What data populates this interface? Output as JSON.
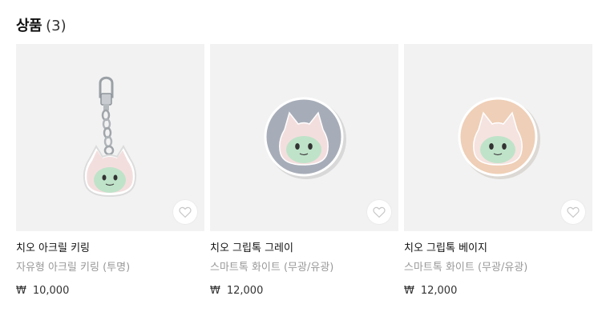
{
  "section": {
    "title": "상품",
    "count": "(3)"
  },
  "products": [
    {
      "title": "치오 아크릴 키링",
      "subtitle": "자유형 아크릴 키링 (투명)",
      "currency": "₩",
      "price": "10,000",
      "image_icon": "acrylic-keyring-image",
      "background_color": "#f2f2f2"
    },
    {
      "title": "치오 그립톡 그레이",
      "subtitle": "스마트톡 화이트 (무광/유광)",
      "currency": "₩",
      "price": "12,000",
      "image_icon": "griptok-gray-image",
      "background_color": "#f2f2f2",
      "accent_color": "#a7adb8"
    },
    {
      "title": "치오 그립톡 베이지",
      "subtitle": "스마트톡 화이트 (무광/유광)",
      "currency": "₩",
      "price": "12,000",
      "image_icon": "griptok-beige-image",
      "background_color": "#f2f2f2",
      "accent_color": "#efcfb7"
    }
  ]
}
